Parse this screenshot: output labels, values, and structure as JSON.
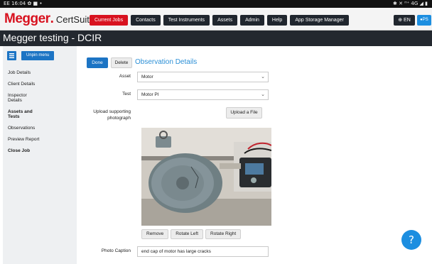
{
  "status_bar": {
    "left_text": "EE 16:04 ✿ ■ •",
    "right_text": "✱ ✕ ᴴ⁺ 4G ◢ ▮"
  },
  "header": {
    "brand": "Megger",
    "product": "CertSuite",
    "nav": [
      {
        "label": "Current Jobs",
        "active": true
      },
      {
        "label": "Contacts",
        "active": false
      },
      {
        "label": "Test Instruments",
        "active": false
      },
      {
        "label": "Assets",
        "active": false
      },
      {
        "label": "Admin",
        "active": false
      },
      {
        "label": "Help",
        "active": false
      },
      {
        "label": "App Storage Manager",
        "active": false
      }
    ],
    "language": "EN",
    "user_initials": "PS",
    "colors": {
      "brand_red": "#d8121f",
      "nav_dark": "#20262e",
      "accent_blue": "#1c74c4"
    }
  },
  "page_title": "Megger testing - DCIR",
  "sidebar": {
    "unpin_label": "Unpin menu",
    "items": [
      {
        "label": "Job Details",
        "bold": false
      },
      {
        "label": "Client Details",
        "bold": false
      },
      {
        "label": "Inspector Details",
        "bold": false
      },
      {
        "label": "Assets and Tests",
        "bold": true
      },
      {
        "label": "Observations",
        "bold": false
      },
      {
        "label": "Preview Report",
        "bold": false
      },
      {
        "label": "Close Job",
        "bold": true
      }
    ]
  },
  "main": {
    "done_label": "Done",
    "delete_label": "Delete",
    "section_title": "Observation Details",
    "asset_label": "Asset",
    "asset_value": "Motor",
    "test_label": "Test",
    "test_value": "Motor PI",
    "upload_label": "Upload supporting photograph",
    "upload_button": "Upload a File",
    "photo_buttons": {
      "remove": "Remove",
      "rotate_left": "Rotate Left",
      "rotate_right": "Rotate Right"
    },
    "caption_label": "Photo Caption",
    "caption_value": "end cap of motor has large cracks"
  },
  "help_label": "?"
}
